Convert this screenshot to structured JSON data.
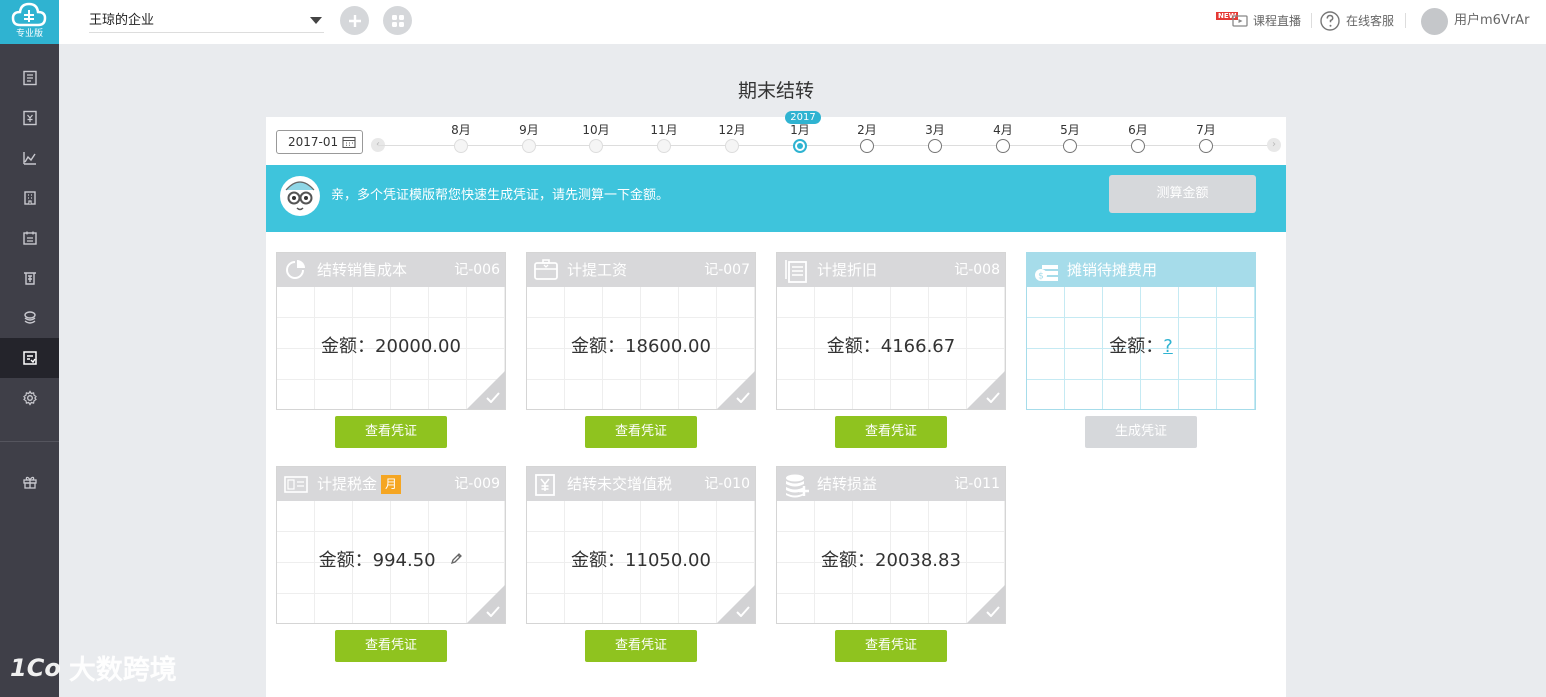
{
  "app": {
    "logo_text": "专业版",
    "brand_color": "#2fb3d1"
  },
  "sidebar": {
    "items": [
      {
        "icon": "voucher-icon"
      },
      {
        "icon": "ledger-icon"
      },
      {
        "icon": "report-chart-icon"
      },
      {
        "icon": "building-icon"
      },
      {
        "icon": "calendar-icon"
      },
      {
        "icon": "invoice-icon"
      },
      {
        "icon": "payroll-icon"
      },
      {
        "icon": "period-closing-icon",
        "active": true
      },
      {
        "icon": "settings-gear-icon"
      },
      {
        "icon": "gift-icon"
      }
    ]
  },
  "topbar": {
    "company": "王琼的企业",
    "new_badge": "NEW",
    "live_course": "课程直播",
    "online_service": "在线客服",
    "user": "用户m6VrAr"
  },
  "page": {
    "title": "期末结转"
  },
  "timeline": {
    "date": "2017-01",
    "year_badge": "2017",
    "months": [
      {
        "label": "8月",
        "state": "past"
      },
      {
        "label": "9月",
        "state": "past"
      },
      {
        "label": "10月",
        "state": "past"
      },
      {
        "label": "11月",
        "state": "past"
      },
      {
        "label": "12月",
        "state": "past"
      },
      {
        "label": "1月",
        "state": "current"
      },
      {
        "label": "2月",
        "state": "future"
      },
      {
        "label": "3月",
        "state": "future"
      },
      {
        "label": "4月",
        "state": "future"
      },
      {
        "label": "5月",
        "state": "future"
      },
      {
        "label": "6月",
        "state": "future"
      },
      {
        "label": "7月",
        "state": "future"
      }
    ]
  },
  "banner": {
    "message": "亲，多个凭证模版帮您快速生成凭证，请先测算一下金额。",
    "calc_button": "测算金额",
    "color": "#3ec4dc"
  },
  "amount_prefix": "金额：",
  "cards": [
    {
      "title": "结转销售成本",
      "code": "记-006",
      "amount": "20000.00",
      "button": "查看凭证",
      "icon": "pie-chart-icon"
    },
    {
      "title": "计提工资",
      "code": "记-007",
      "amount": "18600.00",
      "button": "查看凭证",
      "icon": "wallet-icon"
    },
    {
      "title": "计提折旧",
      "code": "记-008",
      "amount": "4166.67",
      "button": "查看凭证",
      "icon": "documents-icon"
    },
    {
      "title": "摊销待摊费用",
      "code": "",
      "amount": "?",
      "button": "生成凭证",
      "icon": "money-stack-icon"
    },
    {
      "title": "计提税金",
      "tag": "月",
      "code": "记-009",
      "amount": "994.50",
      "button": "查看凭证",
      "icon": "tax-icon"
    },
    {
      "title": "结转未交增值税",
      "code": "记-010",
      "amount": "11050.00",
      "button": "查看凭证",
      "icon": "yuan-doc-icon"
    },
    {
      "title": "结转损益",
      "code": "记-011",
      "amount": "20038.83",
      "button": "查看凭证",
      "icon": "coins-icon"
    }
  ],
  "watermark": {
    "logo": "1Co",
    "text": "大数跨境"
  }
}
